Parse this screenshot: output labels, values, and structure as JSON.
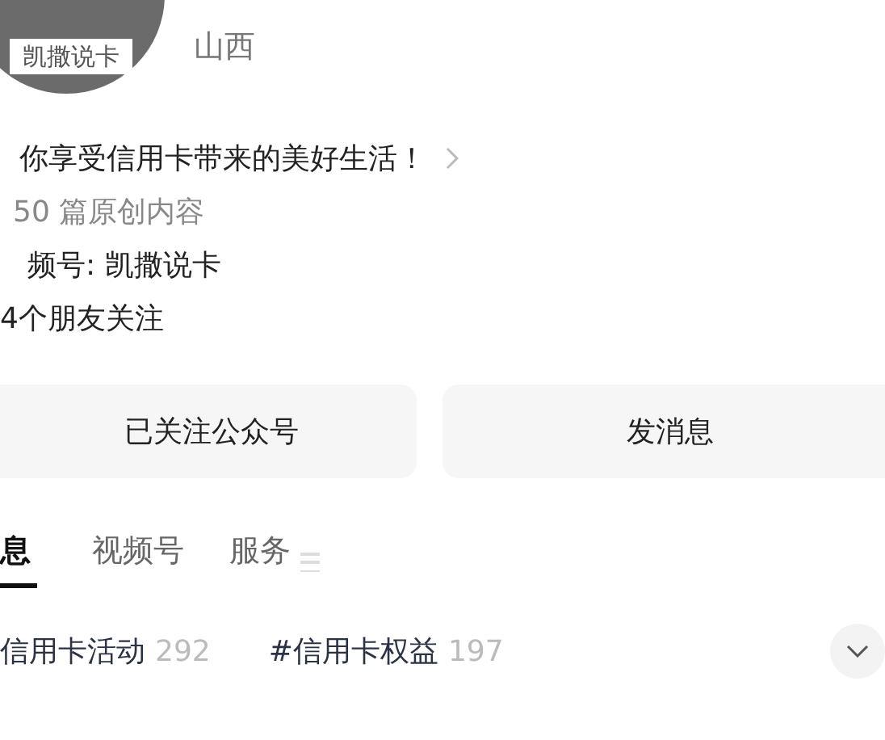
{
  "profile": {
    "avatar_label": "凯撒说卡",
    "location": "山西",
    "bio": "你享受信用卡带来的美好生活！",
    "original_count": "50 篇原创内容",
    "channel": "频号: 凯撒说卡",
    "friends": "4个朋友关注"
  },
  "buttons": [
    {
      "label": "已关注公众号"
    },
    {
      "label": "发消息"
    }
  ],
  "tabs": [
    {
      "label": "息",
      "selected": true
    },
    {
      "label": "视频号",
      "selected": false
    },
    {
      "label": "服务",
      "selected": false
    }
  ],
  "hashtags": [
    {
      "label": "信用卡活动",
      "count": "292"
    },
    {
      "label": "#信用卡权益",
      "count": "197"
    }
  ]
}
